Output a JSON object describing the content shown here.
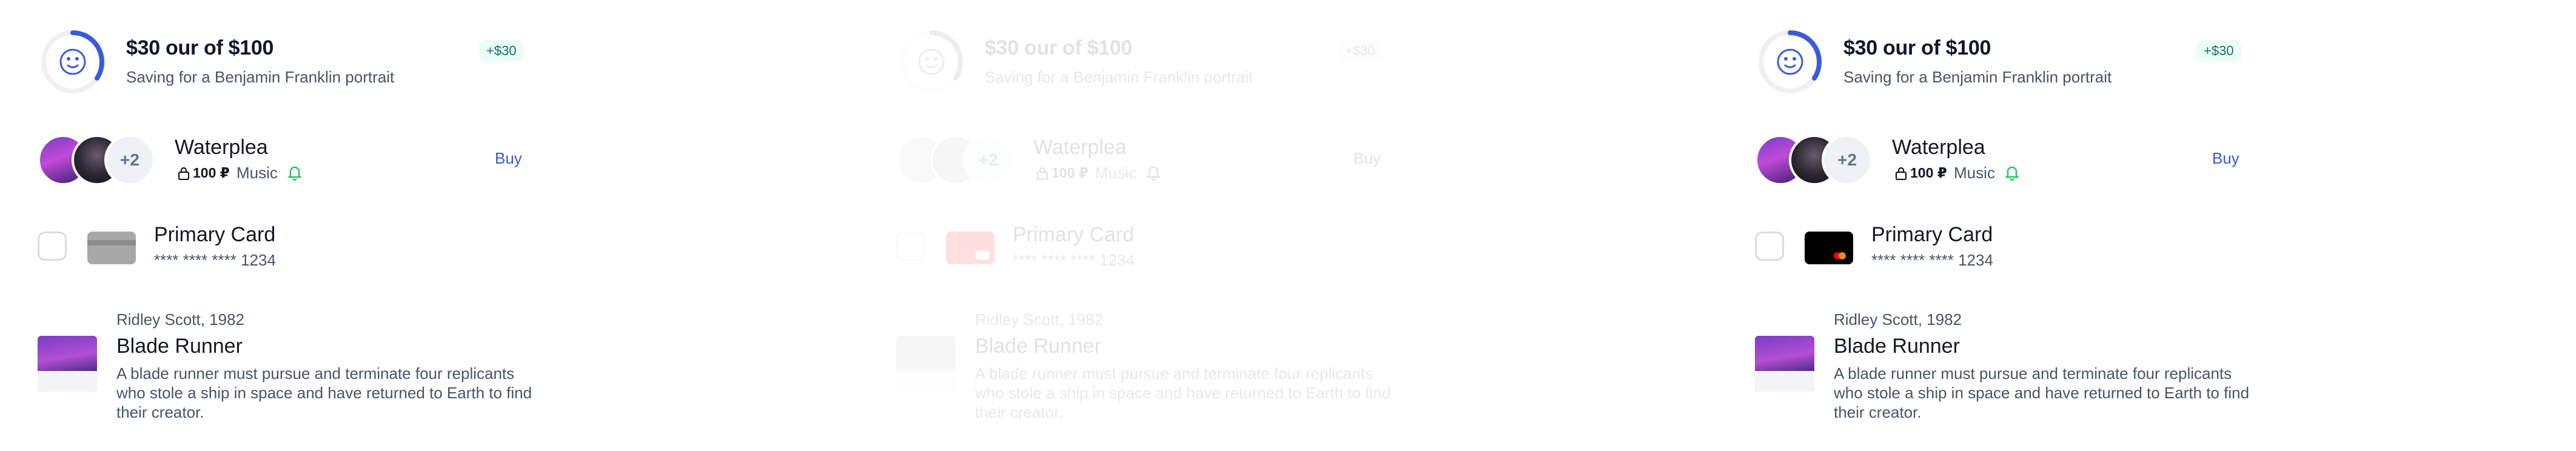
{
  "goal": {
    "title": "$30 our of $100",
    "subtitle": "Saving for a Benjamin Franklin portrait",
    "badge": "+$30",
    "progress_fraction": 0.3,
    "icon": "smile-icon"
  },
  "music": {
    "title": "Waterplea",
    "extra_count": "+2",
    "price": "100 ₽",
    "genre": "Music",
    "buy_label": "Buy",
    "icons": [
      "lock-icon",
      "bell-icon"
    ]
  },
  "card": {
    "title": "Primary Card",
    "number": "**** **** **** 1234"
  },
  "movie": {
    "meta": "Ridley Scott, 1982",
    "title": "Blade Runner",
    "description": "A blade runner must pursue and terminate four replicants who stole a ship in space and have returned to Earth to find their creator."
  },
  "variants": [
    {
      "state": "default",
      "card_color": "#a8a8a8"
    },
    {
      "state": "disabled",
      "card_color": "#ff0000"
    },
    {
      "state": "default",
      "card_color": "#000000"
    }
  ],
  "colors": {
    "accent": "#3b5bdb",
    "badge": "#0f766e",
    "bell": "#22c55e"
  }
}
